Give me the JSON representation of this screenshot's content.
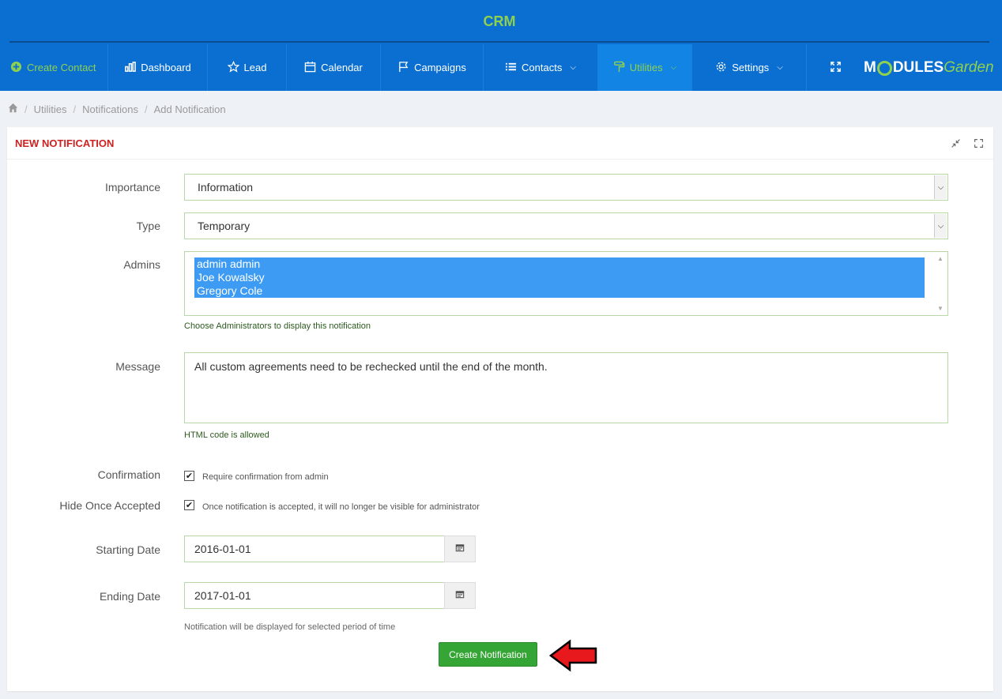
{
  "header": {
    "app_title": "CRM"
  },
  "nav": {
    "create_contact": "Create Contact",
    "dashboard": "Dashboard",
    "lead": "Lead",
    "calendar": "Calendar",
    "campaigns": "Campaigns",
    "contacts": "Contacts",
    "utilities": "Utilities",
    "settings": "Settings",
    "logo_prefix": "M",
    "logo_mid": "DULES",
    "logo_suffix": "Garden"
  },
  "breadcrumb": {
    "items": [
      "Utilities",
      "Notifications",
      "Add Notification"
    ]
  },
  "panel": {
    "title": "NEW NOTIFICATION"
  },
  "form": {
    "importance": {
      "label": "Importance",
      "value": "Information"
    },
    "type": {
      "label": "Type",
      "value": "Temporary"
    },
    "admins": {
      "label": "Admins",
      "options": [
        "admin admin",
        "Joe Kowalsky",
        "Gregory Cole"
      ],
      "help": "Choose Administrators to display this notification"
    },
    "message": {
      "label": "Message",
      "value": "All custom agreements need to be rechecked until the end of the month.",
      "help": "HTML code is allowed"
    },
    "confirmation": {
      "label": "Confirmation",
      "text": "Require confirmation from admin",
      "checked": true
    },
    "hide_once_accepted": {
      "label": "Hide Once Accepted",
      "text": "Once notification is accepted, it will no longer be visible for administrator",
      "checked": true
    },
    "starting_date": {
      "label": "Starting Date",
      "value": "2016-01-01"
    },
    "ending_date": {
      "label": "Ending Date",
      "value": "2017-01-01"
    },
    "date_help": "Notification will be displayed for selected period of time",
    "submit_label": "Create Notification"
  },
  "colors": {
    "header_bg": "#0a6fd0",
    "accent_green": "#8fd14f",
    "submit_green": "#35a535",
    "panel_title_red": "#cc2222",
    "selection_blue": "#3d9bf3"
  }
}
